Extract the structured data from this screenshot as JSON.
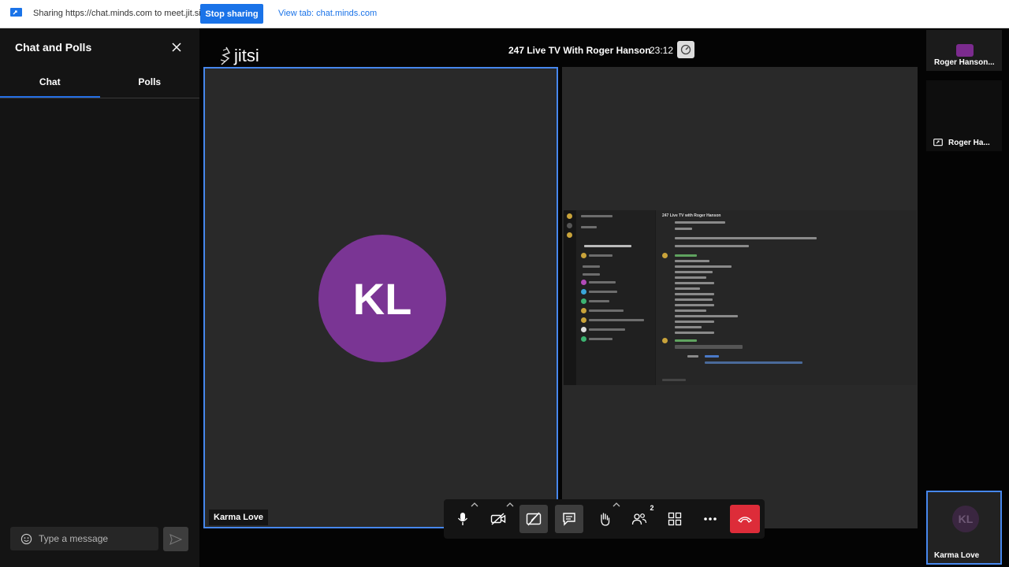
{
  "share_bar": {
    "text": "Sharing https://chat.minds.com to meet.jit.si",
    "stop_label": "Stop sharing",
    "view_tab_label": "View tab: chat.minds.com"
  },
  "chat": {
    "title": "Chat and Polls",
    "tabs": [
      {
        "label": "Chat"
      },
      {
        "label": "Polls"
      }
    ],
    "input_placeholder": "Type a message"
  },
  "header": {
    "logo_text": "jitsi",
    "meeting_title": "247 Live TV With Roger Hanson",
    "timer": "23:12"
  },
  "main_tile": {
    "initials": "KL",
    "name": "Karma Love",
    "avatar_color": "#7a3594"
  },
  "screen_share": {
    "header": "247 Live TV with Roger Hanson"
  },
  "filmstrip": {
    "items": [
      {
        "label": "Roger Hanson..."
      },
      {
        "label": "Roger Ha..."
      },
      {
        "label": "Karma Love",
        "initials": "KL"
      }
    ]
  },
  "toolbar": {
    "participants_count": "2"
  },
  "colors": {
    "accent": "#246fe5",
    "share_button": "#1a73e8",
    "hangup": "#dd2c39"
  }
}
